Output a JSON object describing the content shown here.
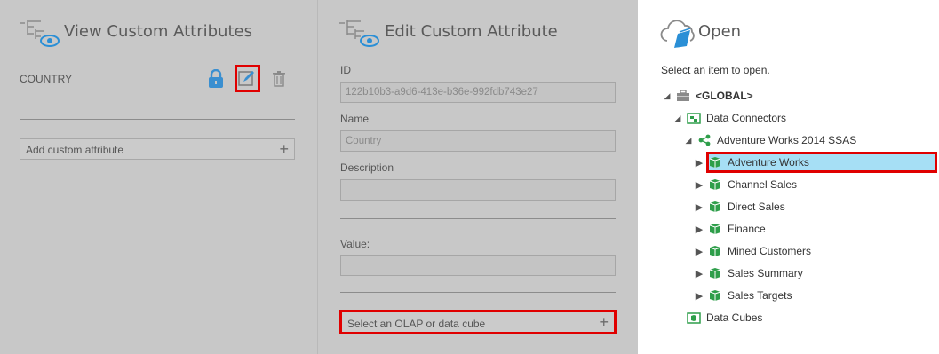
{
  "view_panel": {
    "title": "View Custom Attributes",
    "attribute_name": "COUNTRY",
    "add_label": "Add custom attribute",
    "plus": "+"
  },
  "edit_panel": {
    "title": "Edit Custom Attribute",
    "id_label": "ID",
    "id_value": "122b10b3-a9d6-413e-b36e-992fdb743e27",
    "name_label": "Name",
    "name_value": "Country",
    "description_label": "Description",
    "description_value": "",
    "value_label": "Value:",
    "value_value": "",
    "cube_label": "Select an OLAP or data cube",
    "plus": "+"
  },
  "open_panel": {
    "title": "Open",
    "subtitle": "Select an item to open.",
    "tree": {
      "global": "<GLOBAL>",
      "data_connectors": "Data Connectors",
      "connection": "Adventure Works 2014 SSAS",
      "cubes": [
        "Adventure Works",
        "Channel Sales",
        "Direct Sales",
        "Finance",
        "Mined Customers",
        "Sales Summary",
        "Sales Targets"
      ],
      "data_cubes": "Data Cubes"
    },
    "selected_item": "Adventure Works"
  },
  "colors": {
    "accent_blue": "#2a8fd6",
    "highlight_red": "#e00000",
    "selection": "#a6dff5",
    "cube_green": "#2e9e4a"
  }
}
